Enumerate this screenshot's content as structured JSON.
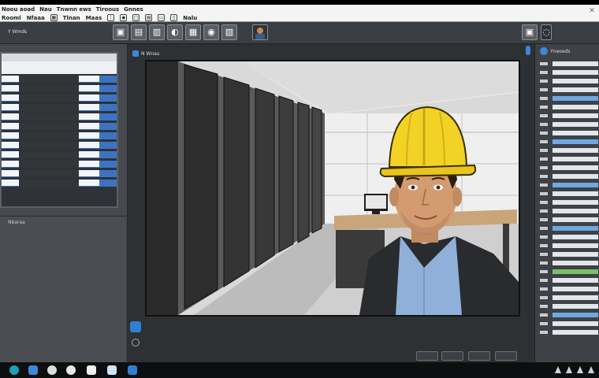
{
  "menubar": {
    "items": [
      "Noou aoad",
      "Nau",
      "Tnwnn ews",
      "Tiroous",
      "Gnnes"
    ],
    "row2": [
      "Rooml",
      "Nfaaa",
      "Tlnan",
      "Maas",
      "Nalu"
    ]
  },
  "toolbar": {
    "label": "Y  Wmds",
    "buttons": [
      "▣",
      "▤",
      "▥",
      "◐",
      "▦",
      "◉",
      "▧"
    ]
  },
  "left_panel": {
    "status_text": "Nbaraa"
  },
  "viewport": {
    "title": "N Wnau"
  },
  "right_panel": {
    "header": "Yneoeds"
  },
  "colors": {
    "accent": "#3a88d8",
    "helmet": "#f2d225",
    "shirt": "#8fb0d8",
    "jacket": "#2a2b2e"
  },
  "icons": {
    "close": "close-icon",
    "shield": "shield-icon"
  }
}
